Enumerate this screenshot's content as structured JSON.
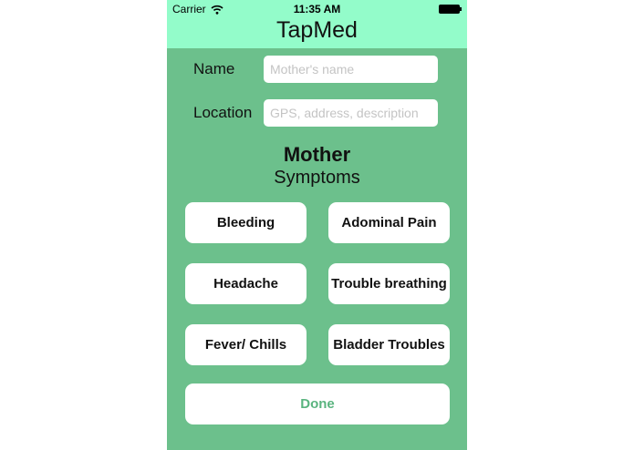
{
  "status_bar": {
    "carrier": "Carrier",
    "time": "11:35 AM"
  },
  "app": {
    "title": "TapMed"
  },
  "form": {
    "name_label": "Name",
    "name_placeholder": "Mother's name",
    "name_value": "",
    "location_label": "Location",
    "location_placeholder": "GPS, address, description",
    "location_value": ""
  },
  "section": {
    "title": "Mother",
    "subtitle": "Symptoms"
  },
  "symptoms": [
    {
      "label": "Bleeding"
    },
    {
      "label": "Adominal Pain"
    },
    {
      "label": "Headache"
    },
    {
      "label": "Trouble breathing"
    },
    {
      "label": "Fever/ Chills"
    },
    {
      "label": "Bladder Troubles"
    }
  ],
  "done_label": "Done",
  "colors": {
    "header_bg": "#93fcca",
    "body_bg": "#6cc08c",
    "done_text": "#5ab47f"
  },
  "icons": [
    "wifi-icon",
    "battery-icon"
  ]
}
